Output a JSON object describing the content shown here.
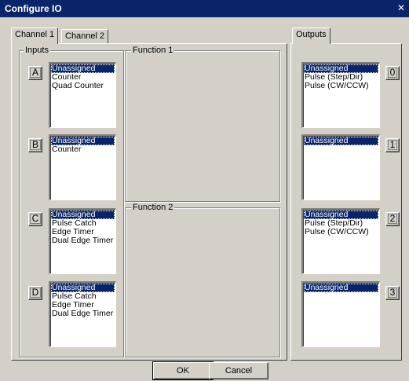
{
  "window": {
    "title": "Configure IO",
    "close_glyph": "✕"
  },
  "tabs": {
    "channel1": "Channel 1",
    "channel2": "Channel 2",
    "outputs": "Outputs"
  },
  "groups": {
    "inputs": "Inputs",
    "function1": "Function 1",
    "function2": "Function 2"
  },
  "inputs": [
    {
      "letter": "A",
      "options": [
        "Unassigned",
        "Counter",
        "Quad Counter"
      ],
      "selected": 0
    },
    {
      "letter": "B",
      "options": [
        "Unassigned",
        "Counter"
      ],
      "selected": 0
    },
    {
      "letter": "C",
      "options": [
        "Unassigned",
        "Pulse Catch",
        "Edge Timer",
        "Dual Edge Timer"
      ],
      "selected": 0
    },
    {
      "letter": "D",
      "options": [
        "Unassigned",
        "Pulse Catch",
        "Edge Timer",
        "Dual Edge Timer"
      ],
      "selected": 0
    }
  ],
  "outputs": [
    {
      "number": "0",
      "options": [
        "Unassigned",
        "Pulse (Step/Dir)",
        "Pulse (CW/CCW)"
      ],
      "selected": 0
    },
    {
      "number": "1",
      "options": [
        "Unassigned"
      ],
      "selected": 0
    },
    {
      "number": "2",
      "options": [
        "Unassigned",
        "Pulse (Step/Dir)",
        "Pulse (CW/CCW)"
      ],
      "selected": 0
    },
    {
      "number": "3",
      "options": [
        "Unassigned"
      ],
      "selected": 0
    }
  ],
  "buttons": {
    "ok": "OK",
    "cancel": "Cancel"
  },
  "colors": {
    "face": "#d4d0c8",
    "titlebar": "#0a246a",
    "selection": "#0a246a",
    "list_bg": "#ffffff"
  }
}
